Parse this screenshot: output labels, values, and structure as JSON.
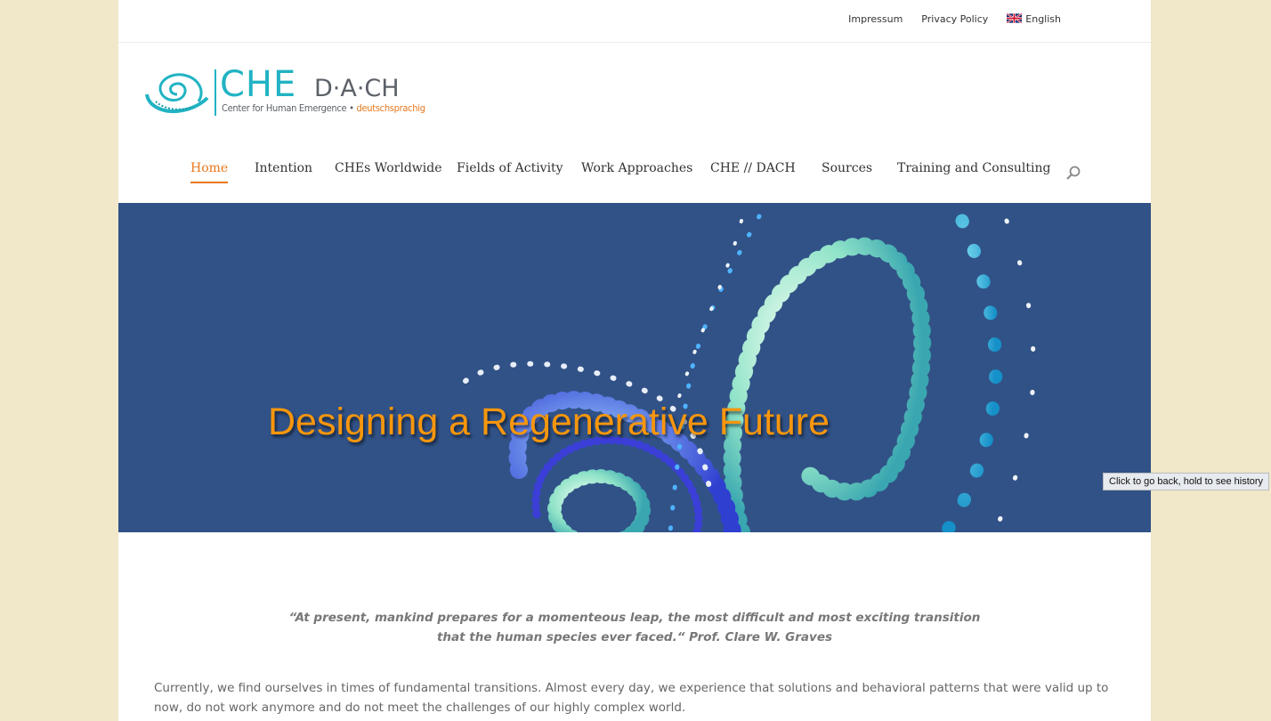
{
  "topbar": {
    "links": [
      "Impressum",
      "Privacy Policy"
    ],
    "language": "English"
  },
  "logo": {
    "name": "CHE",
    "region": "D·A·CH",
    "tagline": "Center for Human Emergence •",
    "tagline_accent": "deutschsprachig"
  },
  "nav": {
    "items": [
      "Home",
      "Intention",
      "CHEs Worldwide",
      "Fields of Activity",
      "Work Approaches",
      "CHE // DACH",
      "Sources",
      "Training and Consulting"
    ],
    "active": "Home"
  },
  "hero": {
    "title": "Designing a Regenerative Future"
  },
  "content": {
    "quote_line1": "“At present, mankind prepares for a momenteous leap, the most difficult and most exciting transition",
    "quote_line2": "that the human species ever faced.“ Prof. Clare W. Graves",
    "paragraph": "Currently, we find ourselves in times of fundamental transitions. Almost every day, we experience that solutions and behavioral patterns that were valid up to now, do not work anymore and do not meet the challenges of our highly complex world."
  },
  "tooltip": "Click to go back, hold to see history",
  "colors": {
    "accent": "#e8781e",
    "brand": "#21b3c3",
    "hero_bg": "#315287",
    "page_bg": "#f1e7c9"
  }
}
